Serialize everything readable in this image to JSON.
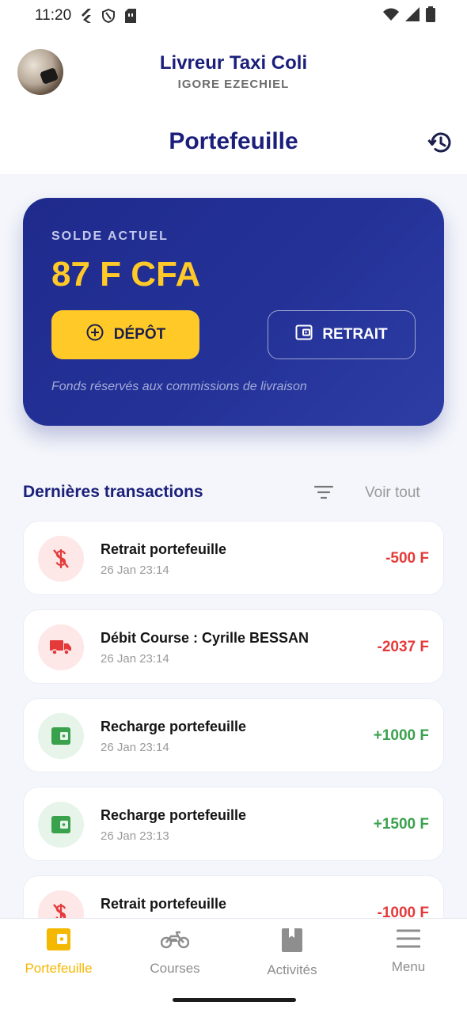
{
  "status_bar": {
    "time": "11:20",
    "left_icons": [
      "flutter-icon",
      "shield-icon",
      "sim-card-icon"
    ],
    "right_icons": [
      "wifi-icon",
      "signal-icon",
      "battery-icon"
    ]
  },
  "header": {
    "app_title": "Livreur Taxi Coli",
    "user_name": "IGORE EZECHIEL",
    "page_title": "Portefeuille",
    "history_icon": "history-icon"
  },
  "balance_card": {
    "label": "SOLDE ACTUEL",
    "amount": "87 F CFA",
    "deposit_label": "DÉPÔT",
    "withdraw_label": "RETRAIT",
    "note": "Fonds réservés aux commissions de livraison",
    "colors": {
      "card": "#1f2a8c",
      "accent": "#ffc928"
    }
  },
  "transactions": {
    "title": "Dernières transactions",
    "see_all": "Voir tout",
    "items": [
      {
        "name": "Retrait portefeuille",
        "date": "26 Jan 23:14",
        "amount": "-500 F",
        "kind": "debit",
        "icon": "money-off-icon"
      },
      {
        "name": "Débit Course : Cyrille BESSAN",
        "date": "26 Jan 23:14",
        "amount": "-2037 F",
        "kind": "debit",
        "icon": "truck-icon"
      },
      {
        "name": "Recharge portefeuille",
        "date": "26 Jan 23:14",
        "amount": "+1000 F",
        "kind": "credit",
        "icon": "wallet-icon"
      },
      {
        "name": "Recharge portefeuille",
        "date": "26 Jan 23:13",
        "amount": "+1500 F",
        "kind": "credit",
        "icon": "wallet-icon"
      },
      {
        "name": "Retrait portefeuille",
        "date": "",
        "amount": "-1000 F",
        "kind": "debit",
        "icon": "money-off-icon"
      }
    ]
  },
  "bottom_nav": {
    "items": [
      {
        "label": "Portefeuille",
        "icon": "wallet-icon",
        "active": true
      },
      {
        "label": "Courses",
        "icon": "motorbike-icon",
        "active": false
      },
      {
        "label": "Activités",
        "icon": "book-icon",
        "active": false
      },
      {
        "label": "Menu",
        "icon": "menu-icon",
        "active": false
      }
    ]
  }
}
